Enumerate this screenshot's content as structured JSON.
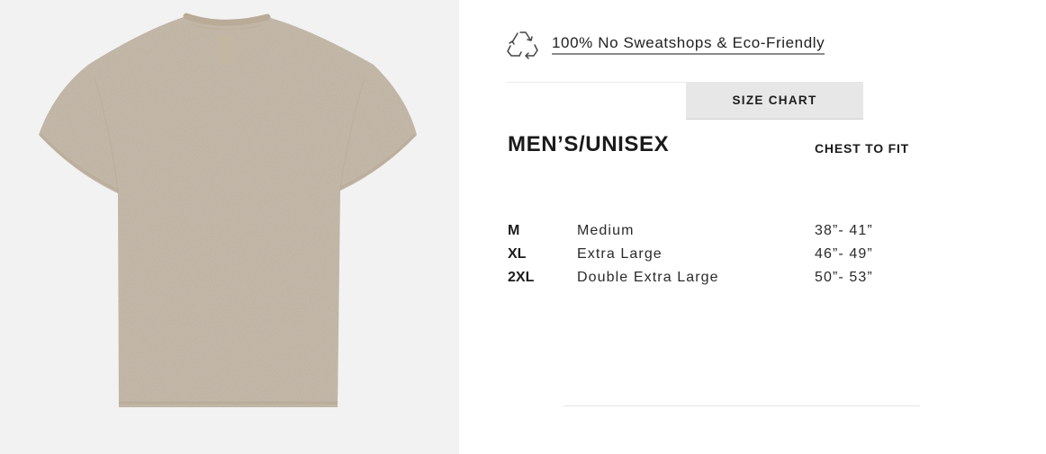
{
  "product": {
    "image_icon": "tshirt-image"
  },
  "eco_link": {
    "icon": "recycle-icon",
    "label": "100% No Sweatshops & Eco-Friendly"
  },
  "tabs": [
    {
      "label": "SIZE CHART",
      "active": true
    }
  ],
  "size_chart": {
    "title": "MEN’S/UNISEX",
    "column_header": "CHEST TO FIT",
    "rows": [
      {
        "code": "M",
        "name": "Medium",
        "chest": "38”- 41”"
      },
      {
        "code": "XL",
        "name": "Extra Large",
        "chest": "46”- 49”"
      },
      {
        "code": "2XL",
        "name": "Double Extra Large",
        "chest": "50”- 53”"
      }
    ]
  },
  "colors": {
    "image_bg": "#f2f2f2",
    "shirt": "#cbbfae",
    "tab_bg": "#e7e7e7",
    "text": "#1c1c1c"
  }
}
